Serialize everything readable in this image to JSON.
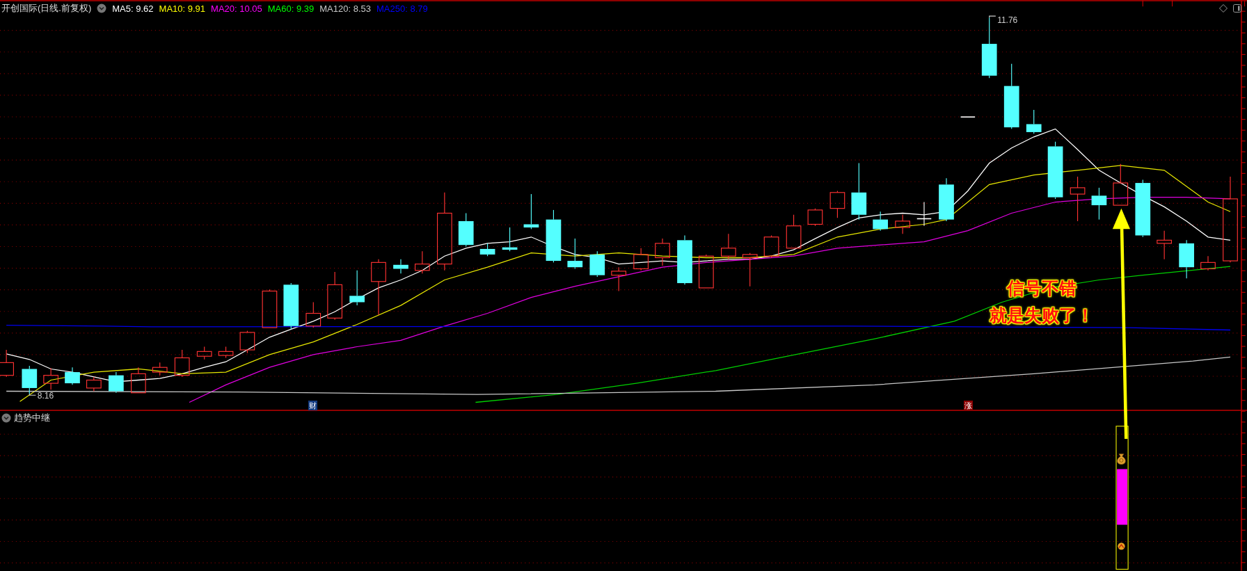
{
  "chart_header": {
    "title": "开创国际(日线.前复权)",
    "ma_legend": [
      {
        "text": "MA5: 9.62",
        "color": "#ffffff"
      },
      {
        "text": "MA10: 9.91",
        "color": "#ffff00"
      },
      {
        "text": "MA20: 10.05",
        "color": "#ff00ff"
      },
      {
        "text": "MA60: 9.39",
        "color": "#00ff00"
      },
      {
        "text": "MA120: 8.53",
        "color": "#c8c8c8"
      },
      {
        "text": "MA250: 8.79",
        "color": "#0000ff"
      }
    ]
  },
  "price_labels": {
    "high": "11.76",
    "low": "8.16"
  },
  "event_markers": [
    {
      "text": "财",
      "color": "#123a80"
    },
    {
      "text": "涨",
      "color": "#8b0000"
    }
  ],
  "annotation": {
    "lines": [
      "信号不错",
      "就是失败了！"
    ]
  },
  "indicator_panel": {
    "title": "趋势中继"
  }
}
